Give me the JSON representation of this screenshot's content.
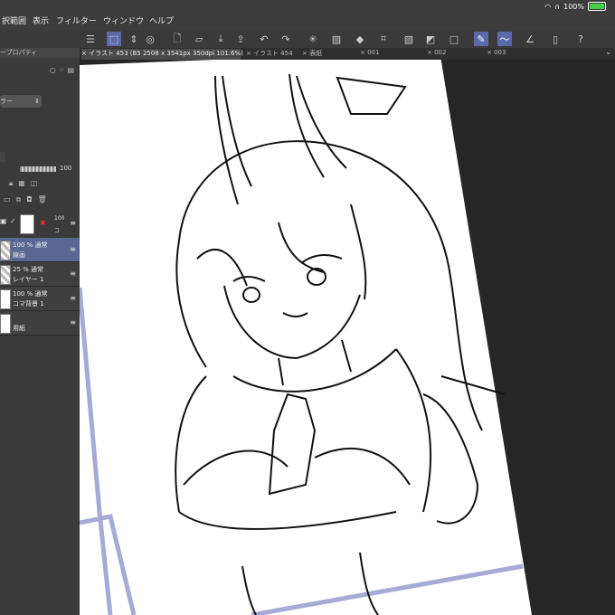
{
  "status": {
    "battery": "100%"
  },
  "menu": [
    "択範囲",
    "表示",
    "フィルター",
    "ウィンドウ",
    "ヘルプ"
  ],
  "left": {
    "panel_title": "ープロパティ",
    "dropdown": "ラー",
    "opacity": "100",
    "layer_top_opacity": "100",
    "layer_top_label": "コ"
  },
  "layers": [
    {
      "mode": "100 % 通常",
      "name": "線画",
      "active": true,
      "thumb": "checker"
    },
    {
      "mode": "25 % 通常",
      "name": "レイヤー 1",
      "active": false,
      "thumb": "checker"
    },
    {
      "mode": "100 % 通常",
      "name": "コマ背景 1",
      "active": false,
      "thumb": "white"
    },
    {
      "mode": "",
      "name": "用紙",
      "active": false,
      "thumb": "white"
    }
  ],
  "tabs": [
    {
      "label": "× イラスト 453 (B5 2508 x 3541px 350dpi 101.6%)",
      "active": true
    },
    {
      "label": "× イラスト 454",
      "active": false
    },
    {
      "label": "× 表紙",
      "active": false
    },
    {
      "label": "× 001",
      "active": false
    },
    {
      "label": "× 002",
      "active": false
    },
    {
      "label": "× 003",
      "active": false
    }
  ],
  "toolbar": {
    "icons": [
      "menu-icon",
      "transform-icon",
      "stepper-icon",
      "view-icon",
      "new-icon",
      "open-icon",
      "save-icon",
      "export-icon",
      "undo-icon",
      "redo-icon",
      "spinner-icon",
      "clear-icon",
      "fill-icon",
      "crop-icon",
      "hatch-icon",
      "tone-icon",
      "frame-icon",
      "pen-icon",
      "pen-curve-icon",
      "ruler-icon",
      "phone-icon",
      "help-icon"
    ]
  }
}
